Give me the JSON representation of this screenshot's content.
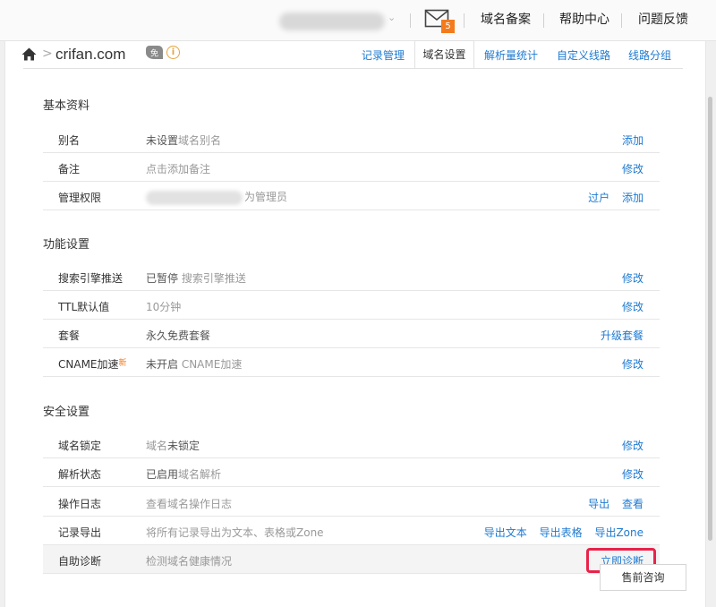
{
  "topbar": {
    "mail_count": "5",
    "links": [
      "域名备案",
      "帮助中心",
      "问题反馈"
    ]
  },
  "header": {
    "domain": "crifan.com",
    "free_badge": "免",
    "info": "i"
  },
  "tabs": [
    {
      "label": "记录管理"
    },
    {
      "label": "域名设置"
    },
    {
      "label": "解析量统计"
    },
    {
      "label": "自定义线路"
    },
    {
      "label": "线路分组"
    }
  ],
  "sections": {
    "basic": {
      "title": "基本资料",
      "rows": [
        {
          "label": "别名",
          "value_bold": "未设置",
          "value": "域名别名",
          "actions": [
            "添加"
          ]
        },
        {
          "label": "备注",
          "value_bold": "",
          "value": "点击添加备注",
          "actions": [
            "修改"
          ]
        },
        {
          "label": "管理权限",
          "value_bold": "",
          "value": "为管理员",
          "actions": [
            "过户",
            "添加"
          ]
        }
      ]
    },
    "feature": {
      "title": "功能设置",
      "rows": [
        {
          "label": "搜索引擎推送",
          "value_bold": "已暂停",
          "value": " 搜索引擎推送",
          "actions": [
            "修改"
          ]
        },
        {
          "label": "TTL默认值",
          "value_bold": "",
          "value": "10分钟",
          "actions": [
            "修改"
          ]
        },
        {
          "label": "套餐",
          "value_bold": "永久免费套餐",
          "value": "",
          "actions": [
            "升级套餐"
          ]
        },
        {
          "label": "CNAME加速",
          "label_sup": "新",
          "value_bold": "未开启",
          "value": " CNAME加速",
          "actions": [
            "修改"
          ]
        }
      ]
    },
    "security": {
      "title": "安全设置",
      "rows": [
        {
          "label": "域名锁定",
          "value_pre": "域名",
          "value_bold": "未锁定",
          "actions": [
            "修改"
          ]
        },
        {
          "label": "解析状态",
          "value_bold": "已启用",
          "value": "域名解析",
          "actions": [
            "修改"
          ]
        },
        {
          "label": "操作日志",
          "value_bold": "",
          "value": "查看域名操作日志",
          "actions": [
            "导出",
            "查看"
          ]
        },
        {
          "label": "记录导出",
          "value_bold": "",
          "value": "将所有记录导出为文本、表格或Zone",
          "actions": [
            "导出文本",
            "导出表格",
            "导出Zone"
          ]
        },
        {
          "label": "自助诊断",
          "value_bold": "",
          "value": "检测域名健康情况",
          "actions": [
            "立即诊断"
          ]
        }
      ]
    }
  },
  "consult_button": "售前咨询",
  "colors": {
    "link": "#1e7ad1",
    "badge": "#f37b1d",
    "highlight": "#e8234a"
  }
}
